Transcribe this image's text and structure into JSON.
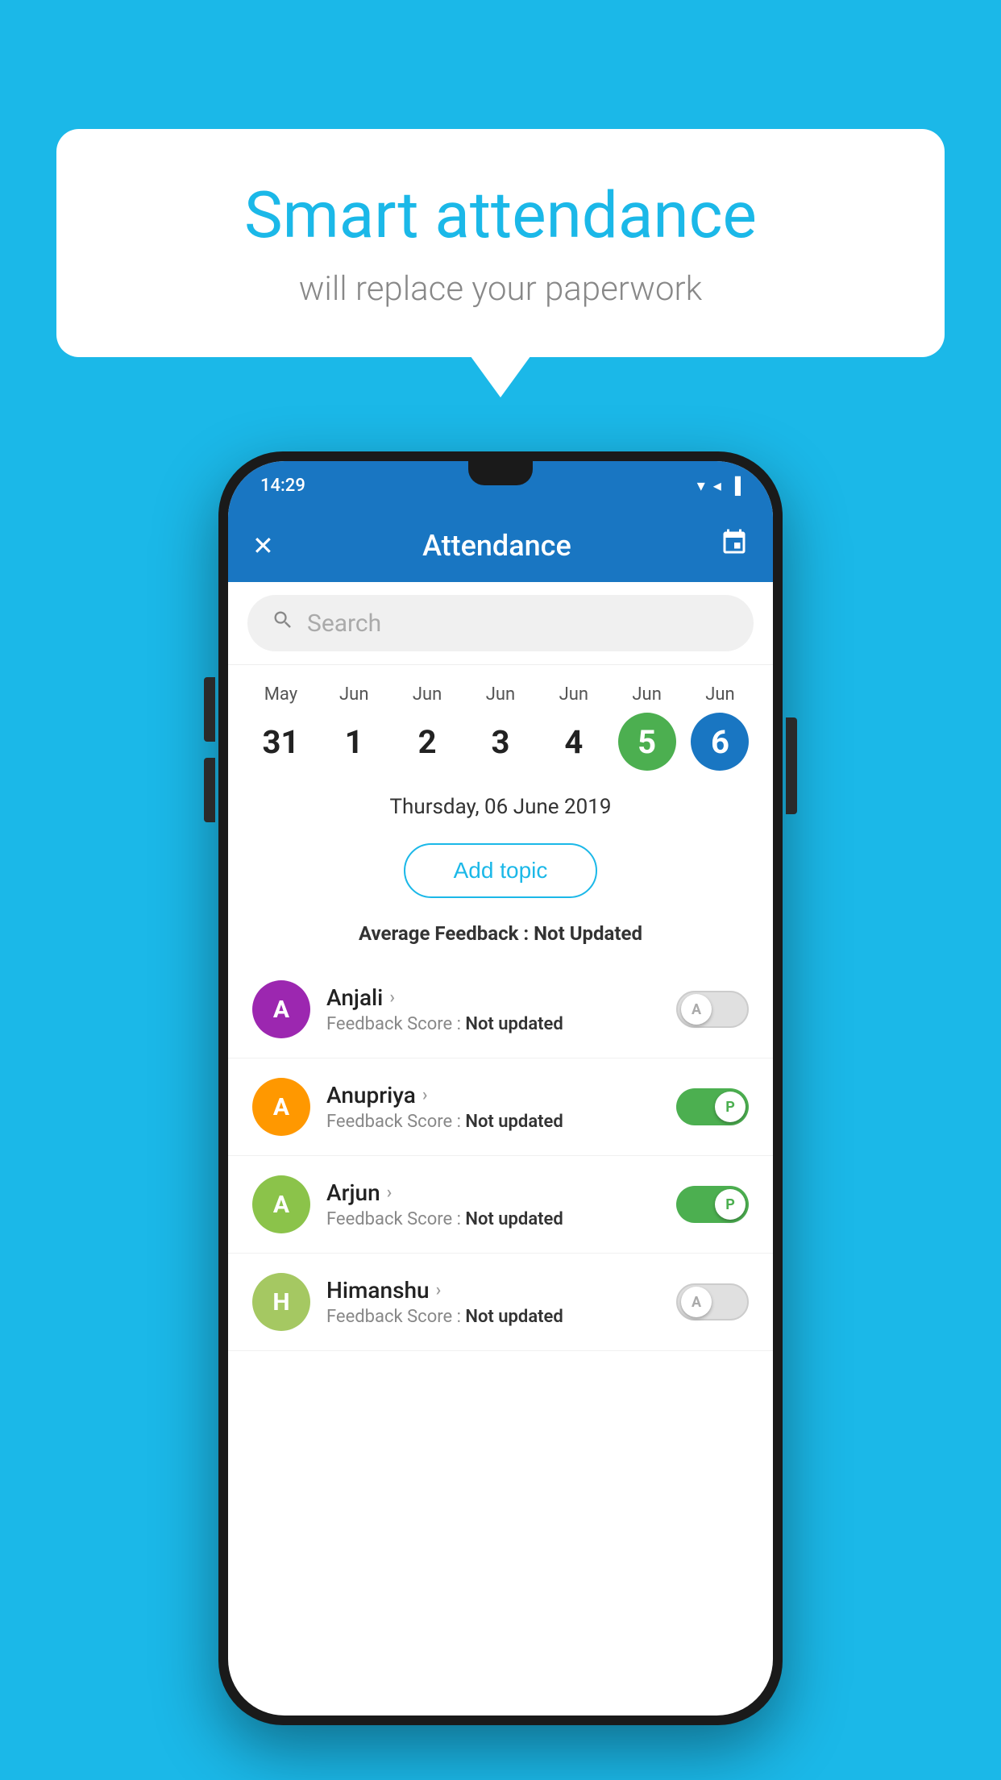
{
  "background_color": "#1bb8e8",
  "speech_bubble": {
    "title": "Smart attendance",
    "subtitle": "will replace your paperwork"
  },
  "status_bar": {
    "time": "14:29",
    "icons": "▼◀▐"
  },
  "app_bar": {
    "title": "Attendance",
    "close_icon": "✕",
    "calendar_icon": "📅"
  },
  "search": {
    "placeholder": "Search"
  },
  "calendar": {
    "days": [
      {
        "month": "May",
        "date": "31",
        "state": "normal"
      },
      {
        "month": "Jun",
        "date": "1",
        "state": "normal"
      },
      {
        "month": "Jun",
        "date": "2",
        "state": "normal"
      },
      {
        "month": "Jun",
        "date": "3",
        "state": "normal"
      },
      {
        "month": "Jun",
        "date": "4",
        "state": "normal"
      },
      {
        "month": "Jun",
        "date": "5",
        "state": "today"
      },
      {
        "month": "Jun",
        "date": "6",
        "state": "selected"
      }
    ]
  },
  "selected_date": "Thursday, 06 June 2019",
  "add_topic_label": "Add topic",
  "avg_feedback": {
    "label": "Average Feedback : ",
    "value": "Not Updated"
  },
  "students": [
    {
      "name": "Anjali",
      "feedback_label": "Feedback Score : ",
      "feedback_value": "Not updated",
      "avatar_letter": "A",
      "avatar_color": "#9c27b0",
      "toggle": "off",
      "toggle_letter": "A"
    },
    {
      "name": "Anupriya",
      "feedback_label": "Feedback Score : ",
      "feedback_value": "Not updated",
      "avatar_letter": "A",
      "avatar_color": "#ff9800",
      "toggle": "on",
      "toggle_letter": "P"
    },
    {
      "name": "Arjun",
      "feedback_label": "Feedback Score : ",
      "feedback_value": "Not updated",
      "avatar_letter": "A",
      "avatar_color": "#8bc34a",
      "toggle": "on",
      "toggle_letter": "P"
    },
    {
      "name": "Himanshu",
      "feedback_label": "Feedback Score : ",
      "feedback_value": "Not updated",
      "avatar_letter": "H",
      "avatar_color": "#a5c862",
      "toggle": "off",
      "toggle_letter": "A"
    }
  ]
}
